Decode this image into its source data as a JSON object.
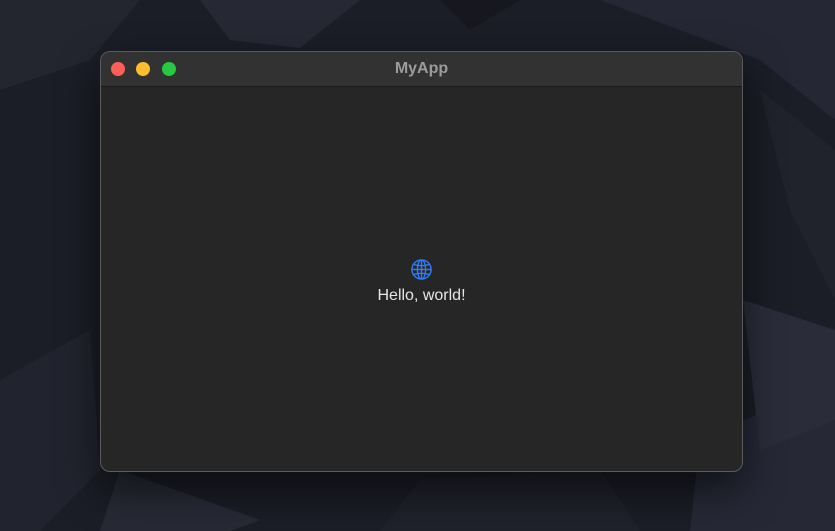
{
  "window": {
    "title": "MyApp",
    "controls": {
      "close_color": "#fe5f57",
      "minimize_color": "#febc2e",
      "zoom_color": "#28c840"
    }
  },
  "content": {
    "icon": "globe-icon",
    "icon_color": "#2f7cf6",
    "greeting": "Hello, world!"
  },
  "theme": {
    "desktop_background": "#1b1d27",
    "window_background": "#262626",
    "titlebar_background": "#323232"
  }
}
